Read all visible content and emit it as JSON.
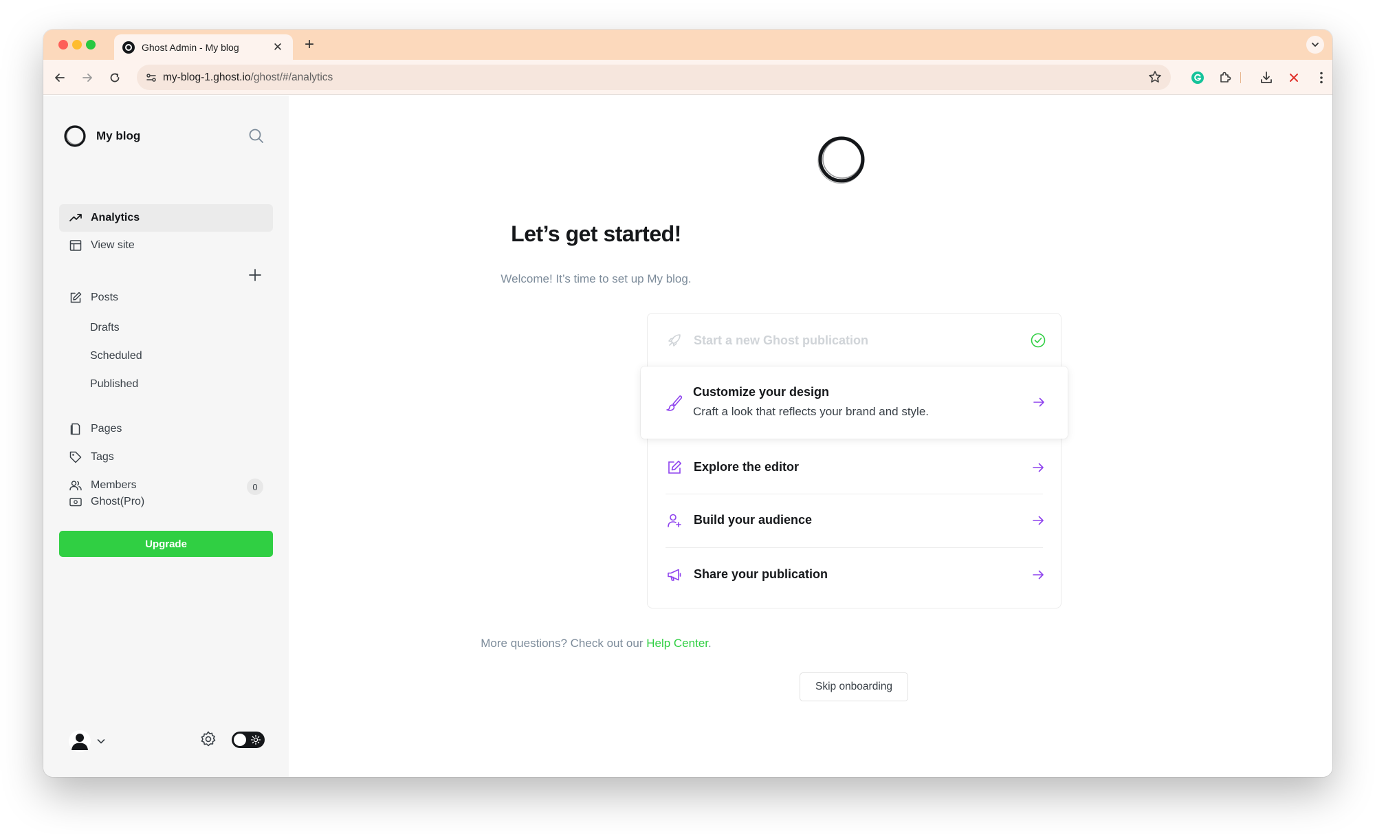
{
  "browser": {
    "tab_title": "Ghost Admin - My blog",
    "url_host": "my-blog-1.ghost.io",
    "url_path": "/ghost/#/analytics"
  },
  "sidebar": {
    "brand": "My blog",
    "nav_top": [
      {
        "label": "Analytics",
        "icon": "trending-up-icon",
        "active": true
      },
      {
        "label": "View site",
        "icon": "layout-icon",
        "active": false
      }
    ],
    "posts": {
      "label": "Posts",
      "icon": "edit-icon",
      "sub_items": [
        "Drafts",
        "Scheduled",
        "Published"
      ]
    },
    "nav_mid": [
      {
        "label": "Pages",
        "icon": "file-icon"
      },
      {
        "label": "Tags",
        "icon": "tag-icon"
      },
      {
        "label": "Members",
        "icon": "users-icon",
        "badge": "0"
      }
    ],
    "ghost_pro": {
      "label": "Ghost(Pro)",
      "icon": "card-icon"
    },
    "upgrade_label": "Upgrade"
  },
  "onboarding": {
    "heading": "Let’s get started!",
    "subheading": "Welcome! It’s time to set up My blog.",
    "steps": [
      {
        "title": "Start a new Ghost publication",
        "icon": "rocket-icon",
        "status": "complete"
      },
      {
        "title": "Customize your design",
        "description": "Craft a look that reflects your brand and style.",
        "icon": "brush-icon",
        "status": "current"
      },
      {
        "title": "Explore the editor",
        "icon": "edit-icon",
        "status": "pending"
      },
      {
        "title": "Build your audience",
        "icon": "user-add-icon",
        "status": "pending"
      },
      {
        "title": "Share your publication",
        "icon": "megaphone-icon",
        "status": "pending"
      }
    ],
    "help_prefix": "More questions? Check out our ",
    "help_link": "Help Center",
    "help_suffix": ".",
    "skip_label": "Skip onboarding"
  },
  "colors": {
    "accent_green": "#30cf43",
    "step_icon_purple": "#8e42ee",
    "tab_bar": "#fcd9bc"
  }
}
